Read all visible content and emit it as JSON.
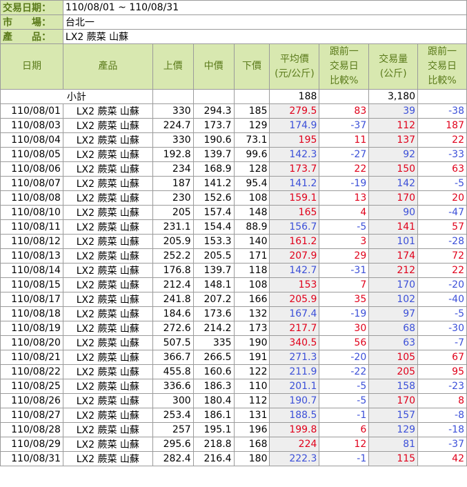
{
  "meta": {
    "date_label": "交易日期：",
    "date_value": "110/08/01 ~ 110/08/31",
    "market_label": "市　　場：",
    "market_value": "台北一",
    "product_label": "產　　品：",
    "product_value": "LX2 蕨菜 山蘇"
  },
  "headers": {
    "date": "日期",
    "product": "產品",
    "upper": "上價",
    "middle": "中價",
    "lower": "下價",
    "avg": [
      "平均價",
      "(元/公斤)"
    ],
    "avg_cmp": [
      "跟前一",
      "交易日",
      "比較%"
    ],
    "volume": [
      "交易量",
      "(公斤)"
    ],
    "vol_cmp": [
      "跟前一",
      "交易日",
      "比較%"
    ]
  },
  "subtotal": {
    "label": "小計",
    "avg": "188",
    "volume": "3,180"
  },
  "rows": [
    {
      "date": "110/08/01",
      "product": "LX2 蕨菜 山蘇",
      "upper": "330",
      "middle": "294.3",
      "lower": "185",
      "avg": "279.5",
      "avg_cmp": "83",
      "volume": "39",
      "vol_cmp": "-38"
    },
    {
      "date": "110/08/03",
      "product": "LX2 蕨菜 山蘇",
      "upper": "224.7",
      "middle": "173.7",
      "lower": "129",
      "avg": "174.9",
      "avg_cmp": "-37",
      "volume": "112",
      "vol_cmp": "187"
    },
    {
      "date": "110/08/04",
      "product": "LX2 蕨菜 山蘇",
      "upper": "330",
      "middle": "190.6",
      "lower": "73.1",
      "avg": "195",
      "avg_cmp": "11",
      "volume": "137",
      "vol_cmp": "22"
    },
    {
      "date": "110/08/05",
      "product": "LX2 蕨菜 山蘇",
      "upper": "192.8",
      "middle": "139.7",
      "lower": "99.6",
      "avg": "142.3",
      "avg_cmp": "-27",
      "volume": "92",
      "vol_cmp": "-33"
    },
    {
      "date": "110/08/06",
      "product": "LX2 蕨菜 山蘇",
      "upper": "234",
      "middle": "168.9",
      "lower": "128",
      "avg": "173.7",
      "avg_cmp": "22",
      "volume": "150",
      "vol_cmp": "63"
    },
    {
      "date": "110/08/07",
      "product": "LX2 蕨菜 山蘇",
      "upper": "187",
      "middle": "141.2",
      "lower": "95.4",
      "avg": "141.2",
      "avg_cmp": "-19",
      "volume": "142",
      "vol_cmp": "-5"
    },
    {
      "date": "110/08/08",
      "product": "LX2 蕨菜 山蘇",
      "upper": "230",
      "middle": "152.6",
      "lower": "108",
      "avg": "159.1",
      "avg_cmp": "13",
      "volume": "170",
      "vol_cmp": "20"
    },
    {
      "date": "110/08/10",
      "product": "LX2 蕨菜 山蘇",
      "upper": "205",
      "middle": "157.4",
      "lower": "148",
      "avg": "165",
      "avg_cmp": "4",
      "volume": "90",
      "vol_cmp": "-47"
    },
    {
      "date": "110/08/11",
      "product": "LX2 蕨菜 山蘇",
      "upper": "231.1",
      "middle": "154.4",
      "lower": "88.9",
      "avg": "156.7",
      "avg_cmp": "-5",
      "volume": "141",
      "vol_cmp": "57"
    },
    {
      "date": "110/08/12",
      "product": "LX2 蕨菜 山蘇",
      "upper": "205.9",
      "middle": "153.3",
      "lower": "140",
      "avg": "161.2",
      "avg_cmp": "3",
      "volume": "101",
      "vol_cmp": "-28"
    },
    {
      "date": "110/08/13",
      "product": "LX2 蕨菜 山蘇",
      "upper": "252.2",
      "middle": "205.5",
      "lower": "171",
      "avg": "207.9",
      "avg_cmp": "29",
      "volume": "174",
      "vol_cmp": "72"
    },
    {
      "date": "110/08/14",
      "product": "LX2 蕨菜 山蘇",
      "upper": "176.8",
      "middle": "139.7",
      "lower": "118",
      "avg": "142.7",
      "avg_cmp": "-31",
      "volume": "212",
      "vol_cmp": "22"
    },
    {
      "date": "110/08/15",
      "product": "LX2 蕨菜 山蘇",
      "upper": "212.4",
      "middle": "148.1",
      "lower": "108",
      "avg": "153",
      "avg_cmp": "7",
      "volume": "170",
      "vol_cmp": "-20"
    },
    {
      "date": "110/08/17",
      "product": "LX2 蕨菜 山蘇",
      "upper": "241.8",
      "middle": "207.2",
      "lower": "166",
      "avg": "205.9",
      "avg_cmp": "35",
      "volume": "102",
      "vol_cmp": "-40"
    },
    {
      "date": "110/08/18",
      "product": "LX2 蕨菜 山蘇",
      "upper": "184.6",
      "middle": "173.6",
      "lower": "132",
      "avg": "167.4",
      "avg_cmp": "-19",
      "volume": "97",
      "vol_cmp": "-5"
    },
    {
      "date": "110/08/19",
      "product": "LX2 蕨菜 山蘇",
      "upper": "272.6",
      "middle": "214.2",
      "lower": "173",
      "avg": "217.7",
      "avg_cmp": "30",
      "volume": "68",
      "vol_cmp": "-30"
    },
    {
      "date": "110/08/20",
      "product": "LX2 蕨菜 山蘇",
      "upper": "507.5",
      "middle": "335",
      "lower": "190",
      "avg": "340.5",
      "avg_cmp": "56",
      "volume": "63",
      "vol_cmp": "-7"
    },
    {
      "date": "110/08/21",
      "product": "LX2 蕨菜 山蘇",
      "upper": "366.7",
      "middle": "266.5",
      "lower": "191",
      "avg": "271.3",
      "avg_cmp": "-20",
      "volume": "105",
      "vol_cmp": "67"
    },
    {
      "date": "110/08/22",
      "product": "LX2 蕨菜 山蘇",
      "upper": "455.8",
      "middle": "160.6",
      "lower": "122",
      "avg": "211.9",
      "avg_cmp": "-22",
      "volume": "205",
      "vol_cmp": "95"
    },
    {
      "date": "110/08/25",
      "product": "LX2 蕨菜 山蘇",
      "upper": "336.6",
      "middle": "186.3",
      "lower": "110",
      "avg": "201.1",
      "avg_cmp": "-5",
      "volume": "158",
      "vol_cmp": "-23"
    },
    {
      "date": "110/08/26",
      "product": "LX2 蕨菜 山蘇",
      "upper": "300",
      "middle": "180.4",
      "lower": "112",
      "avg": "190.7",
      "avg_cmp": "-5",
      "volume": "170",
      "vol_cmp": "8"
    },
    {
      "date": "110/08/27",
      "product": "LX2 蕨菜 山蘇",
      "upper": "253.4",
      "middle": "186.1",
      "lower": "131",
      "avg": "188.5",
      "avg_cmp": "-1",
      "volume": "157",
      "vol_cmp": "-8"
    },
    {
      "date": "110/08/28",
      "product": "LX2 蕨菜 山蘇",
      "upper": "257",
      "middle": "195.1",
      "lower": "196",
      "avg": "199.8",
      "avg_cmp": "6",
      "volume": "129",
      "vol_cmp": "-18"
    },
    {
      "date": "110/08/29",
      "product": "LX2 蕨菜 山蘇",
      "upper": "295.6",
      "middle": "218.8",
      "lower": "168",
      "avg": "224",
      "avg_cmp": "12",
      "volume": "81",
      "vol_cmp": "-37"
    },
    {
      "date": "110/08/31",
      "product": "LX2 蕨菜 山蘇",
      "upper": "282.4",
      "middle": "216.4",
      "lower": "180",
      "avg": "222.3",
      "avg_cmp": "-1",
      "volume": "115",
      "vol_cmp": "42"
    }
  ],
  "colors": {
    "header_bg": "#d8e8b0",
    "header_text": "#5a7a1a",
    "up": "#e0001a",
    "down": "#3b4fd8",
    "shade": "#eeeeee"
  }
}
